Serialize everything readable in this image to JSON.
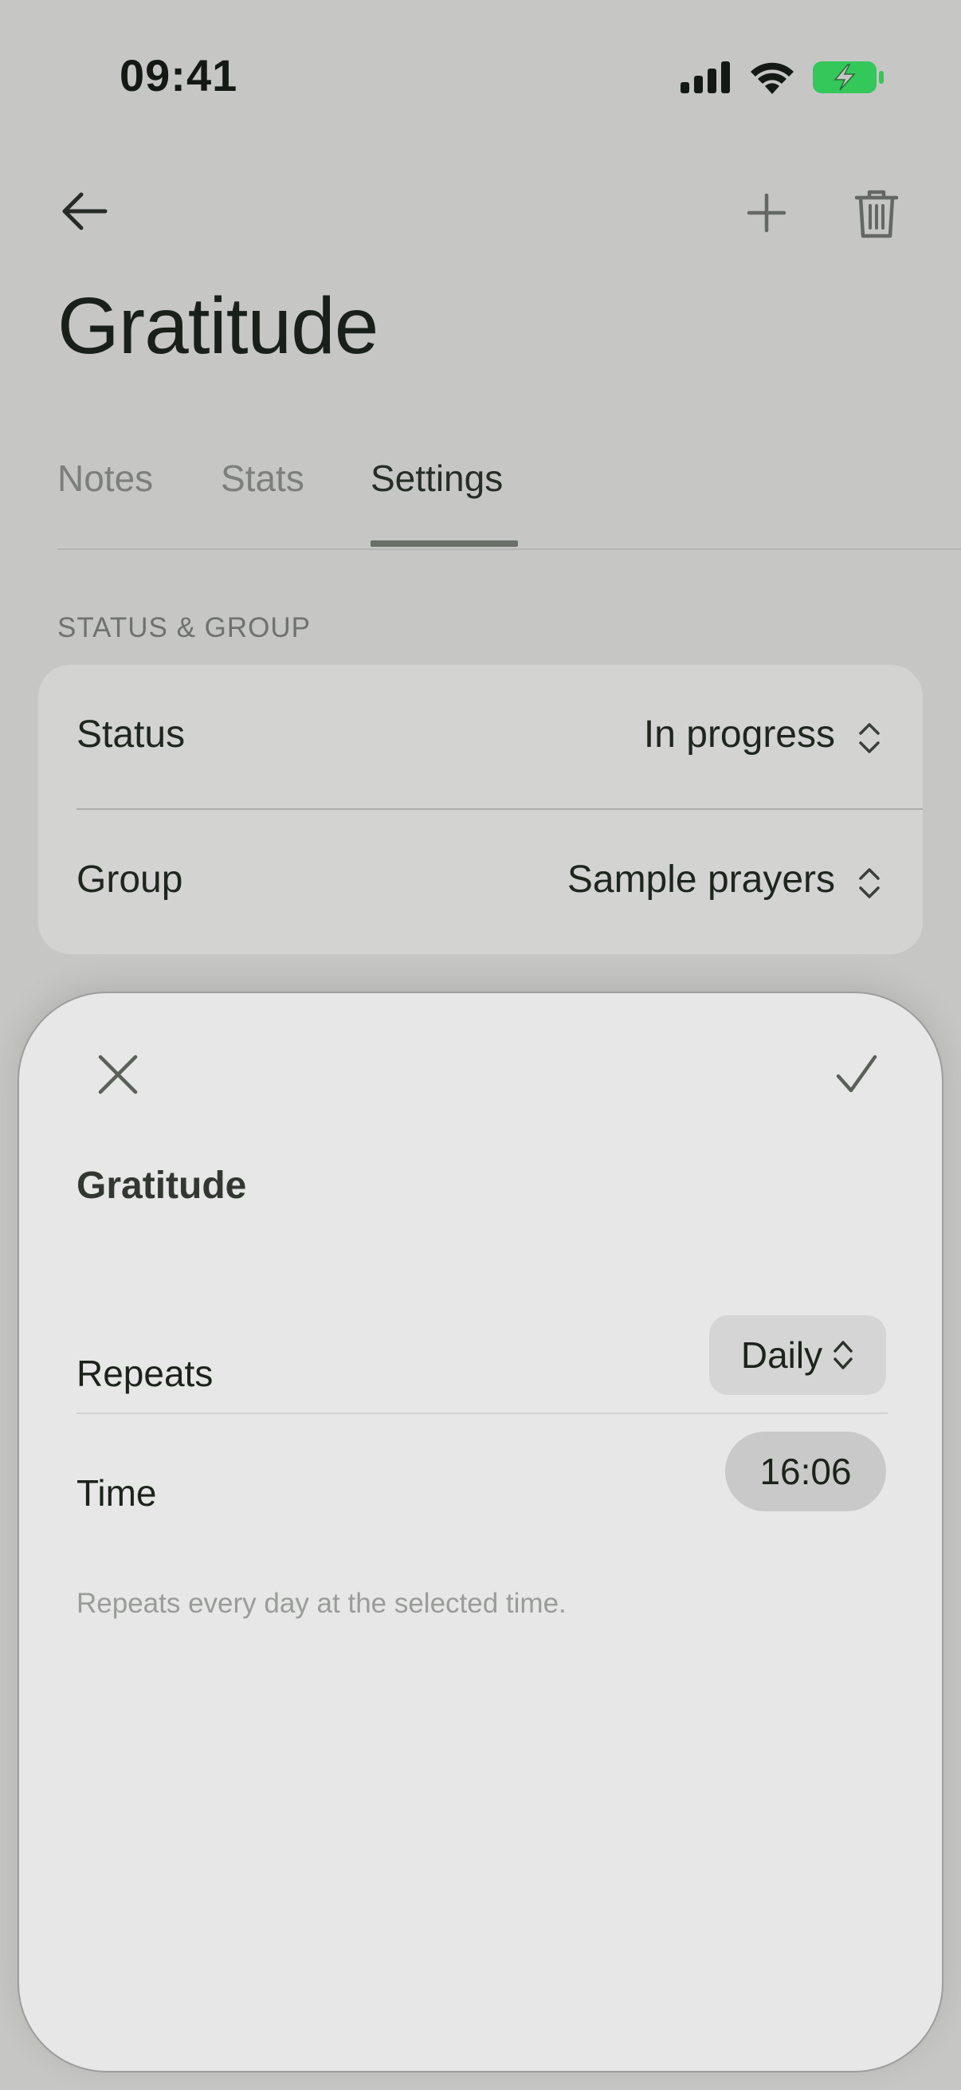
{
  "status_bar": {
    "time": "09:41"
  },
  "header": {
    "title": "Gratitude"
  },
  "tabs": [
    {
      "label": "Notes"
    },
    {
      "label": "Stats"
    },
    {
      "label": "Settings",
      "active": true
    }
  ],
  "section": {
    "label": "STATUS & GROUP"
  },
  "settings": [
    {
      "label": "Status",
      "value": "In progress"
    },
    {
      "label": "Group",
      "value": "Sample prayers"
    }
  ],
  "sheet": {
    "title": "Gratitude",
    "repeats_label": "Repeats",
    "repeats_value": "Daily",
    "time_label": "Time",
    "time_value": "16:06",
    "help_text": "Repeats every day at the selected time."
  },
  "colors": {
    "background": "#c6c6c5",
    "card": "#d3d3d2",
    "sheet": "#e6e7e6",
    "battery_green": "#34c759",
    "text": "#1c231b"
  }
}
